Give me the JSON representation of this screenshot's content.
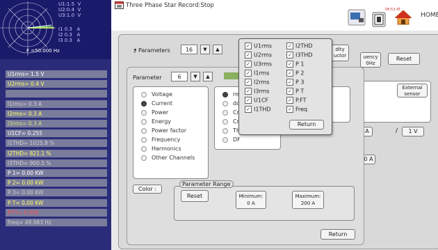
{
  "vector": {
    "voltages": "U1:1.5  V\nU2:0.4  V\nU3:1.0  V",
    "currents": "I1 0.3   A\nI2 0.3   A\nI3 0.3   A",
    "frequency": "F =50.000 Hz"
  },
  "measurements": [
    {
      "text": "U1rms= 1.5 V",
      "color": "#ffffff"
    },
    {
      "text": "U2rms= 0.4 V",
      "color": "#ffff66"
    },
    {
      "text": "",
      "color": "#cccccc"
    },
    {
      "text": "I1rms= 0.3 A",
      "color": "#cfcfcf"
    },
    {
      "text": "I2rms= 0.3 A",
      "color": "#ffff66"
    },
    {
      "text": "I3rms= 0.3 A",
      "color": "#cfe07a"
    },
    {
      "text": "U1CF= 0.255",
      "color": "#ffffff"
    },
    {
      "text": "I1THD= 1025.8 %",
      "color": "#cfcfcf"
    },
    {
      "text": "I2THD= 821.1 %",
      "color": "#ffff66"
    },
    {
      "text": "I3THD= 900.5 %",
      "color": "#cfcfcf"
    },
    {
      "text": "P 1= 0.00 KW",
      "color": "#ffffff"
    },
    {
      "text": "P 2= 0.00 KW",
      "color": "#ffff66"
    },
    {
      "text": "P 3= 0.00 KW",
      "color": "#cfcfcf"
    },
    {
      "text": "P T= 0.00 KW",
      "color": "#ffff66"
    },
    {
      "text": "P.FT= 0.950",
      "color": "#ff5555"
    },
    {
      "text": "Freq= 49.983 Hz",
      "color": "#cfcfcf"
    }
  ],
  "topbar": {
    "title": "Three Phase Star Record:Stop",
    "time": "08:53 AT",
    "home_label": "HOME"
  },
  "outer_dialog": {
    "parameters_label": "Parameters",
    "parameters_value": "16",
    "freq_button": "uency\n0Hz",
    "reset_label": "Reset",
    "external_sensor": "External\nsensor",
    "ratio_a": "A",
    "ratio_slash": "/",
    "ratio_v": "1 V",
    "field_a": "0 A",
    "ity_label": "dity\nuctor"
  },
  "inner_dialog": {
    "parameter_label": "Parameter",
    "parameter_value": "6",
    "radios": [
      "Voltage",
      "Current",
      "Power",
      "Energy",
      "Power factor",
      "Frequency",
      "Harmonics",
      "Other Channels"
    ],
    "selected_index": 1,
    "sub_radios": [
      "rm",
      "dc",
      "Cr",
      "Cr",
      "TH",
      "DF"
    ],
    "color_label": "Color :",
    "range_title": "Parameter Range",
    "range_reset": "Reset",
    "minimum_label": "Minimum:",
    "minimum_value": "0 A",
    "maximum_label": "Maximum:",
    "maximum_value": "200 A",
    "return_label": "Return"
  },
  "popup": {
    "col1": [
      "U1rms",
      "U2rms",
      "U3rms",
      "I1rms",
      "I2rms",
      "I3rms",
      "U1CF",
      "I1THD"
    ],
    "col2": [
      "I2THD",
      "I3THD",
      "P 1",
      "P 2",
      "P 3",
      "P T",
      "P.FT",
      "Freq"
    ],
    "return_label": "Return"
  },
  "icons": {
    "title_icon": "window-icon",
    "computer_icon": "computer-icon",
    "clock_icon": "clock-icon",
    "home_icon": "home-icon"
  }
}
